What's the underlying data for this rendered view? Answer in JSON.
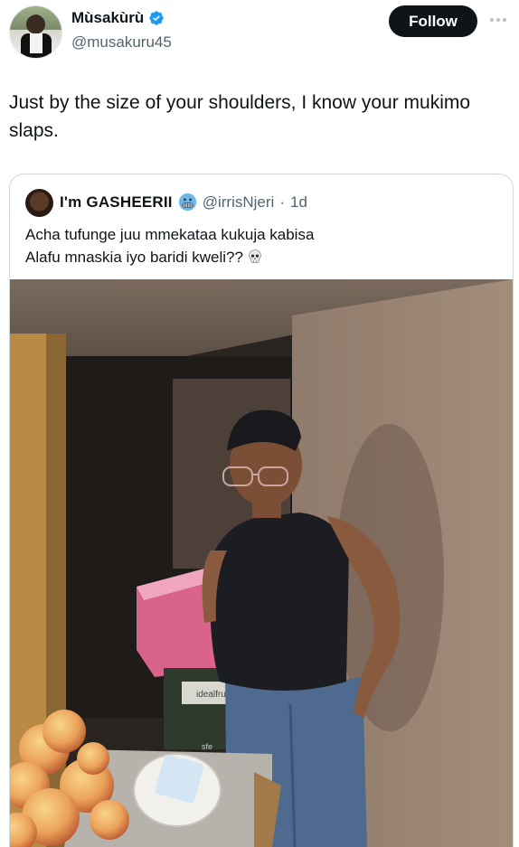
{
  "author": {
    "display_name": "Mùsakùrù",
    "handle": "@musakuru45",
    "verified": true
  },
  "follow_label": "Follow",
  "tweet_text": "Just by the size of your shoulders, I know your mukimo slaps.",
  "quoted": {
    "display_name": "I'm GASHEERII",
    "handle": "@irrisNjeri",
    "separator": "·",
    "time": "1d",
    "line1": "Acha tufunge juu mmekataa kukuja kabisa",
    "line2": "Alafu mnaskia iyo baridi kweli??",
    "name_emoji": "grimacing-cold-face-icon",
    "trailing_emoji": "skull-icon"
  },
  "media": {
    "box_brand_text": "idealfru",
    "box_brand_text_2": "sfe"
  },
  "colors": {
    "follow_bg": "#0f1419",
    "verified_blue": "#1d9bf0",
    "secondary_text": "#536471",
    "border": "#cfd9de"
  }
}
